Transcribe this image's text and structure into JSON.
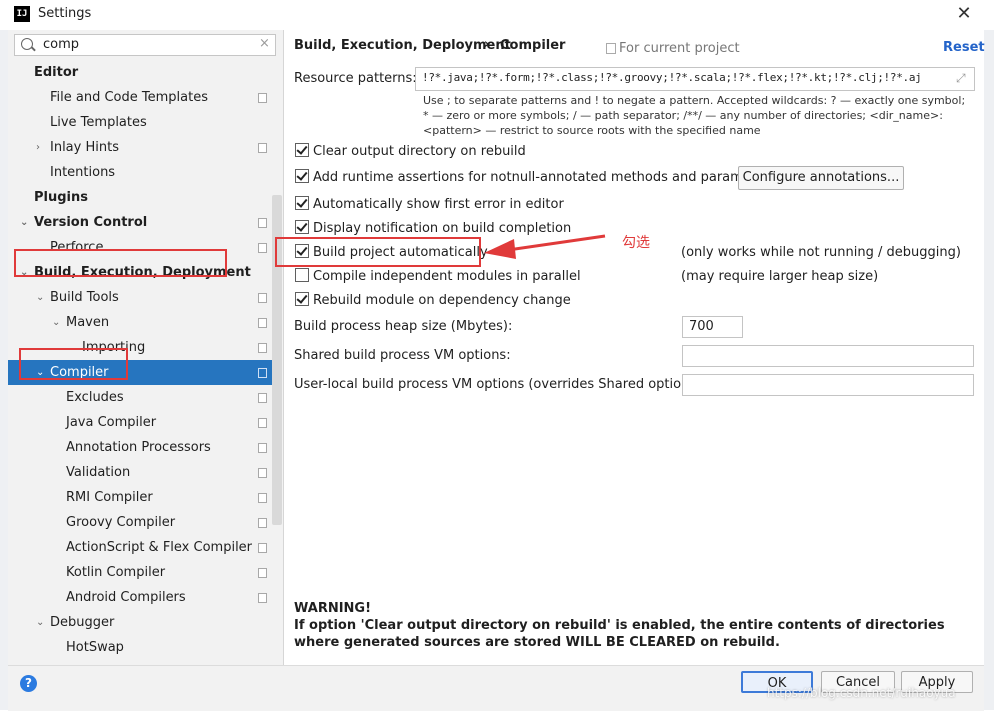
{
  "window": {
    "title": "Settings",
    "app_icon_text": "IJ"
  },
  "search": {
    "value": "comp",
    "clear_glyph": "×"
  },
  "tree": [
    {
      "label": "Editor",
      "bold": true,
      "indent": 26,
      "arrow": "",
      "page_icon": false
    },
    {
      "label": "File and Code Templates",
      "bold": false,
      "indent": 42,
      "arrow": "",
      "page_icon": true
    },
    {
      "label": "Live Templates",
      "bold": false,
      "indent": 42,
      "arrow": "",
      "page_icon": false
    },
    {
      "label": "Inlay Hints",
      "bold": false,
      "indent": 42,
      "arrow": "›",
      "page_icon": true
    },
    {
      "label": "Intentions",
      "bold": false,
      "indent": 42,
      "arrow": "",
      "page_icon": false
    },
    {
      "label": "Plugins",
      "bold": true,
      "indent": 26,
      "arrow": "",
      "page_icon": false
    },
    {
      "label": "Version Control",
      "bold": true,
      "indent": 26,
      "arrow": "⌄",
      "page_icon": true
    },
    {
      "label": "Perforce",
      "bold": false,
      "indent": 42,
      "arrow": "",
      "page_icon": true
    },
    {
      "label": "Build, Execution, Deployment",
      "bold": true,
      "indent": 26,
      "arrow": "⌄",
      "page_icon": false
    },
    {
      "label": "Build Tools",
      "bold": false,
      "indent": 42,
      "arrow": "⌄",
      "page_icon": true
    },
    {
      "label": "Maven",
      "bold": false,
      "indent": 58,
      "arrow": "⌄",
      "page_icon": true
    },
    {
      "label": "Importing",
      "bold": false,
      "indent": 74,
      "arrow": "",
      "page_icon": true
    },
    {
      "label": "Compiler",
      "bold": false,
      "indent": 42,
      "arrow": "⌄",
      "page_icon": true,
      "selected": true
    },
    {
      "label": "Excludes",
      "bold": false,
      "indent": 58,
      "arrow": "",
      "page_icon": true
    },
    {
      "label": "Java Compiler",
      "bold": false,
      "indent": 58,
      "arrow": "",
      "page_icon": true
    },
    {
      "label": "Annotation Processors",
      "bold": false,
      "indent": 58,
      "arrow": "",
      "page_icon": true
    },
    {
      "label": "Validation",
      "bold": false,
      "indent": 58,
      "arrow": "",
      "page_icon": true
    },
    {
      "label": "RMI Compiler",
      "bold": false,
      "indent": 58,
      "arrow": "",
      "page_icon": true
    },
    {
      "label": "Groovy Compiler",
      "bold": false,
      "indent": 58,
      "arrow": "",
      "page_icon": true
    },
    {
      "label": "ActionScript & Flex Compiler",
      "bold": false,
      "indent": 58,
      "arrow": "",
      "page_icon": true
    },
    {
      "label": "Kotlin Compiler",
      "bold": false,
      "indent": 58,
      "arrow": "",
      "page_icon": true
    },
    {
      "label": "Android Compilers",
      "bold": false,
      "indent": 58,
      "arrow": "",
      "page_icon": true
    },
    {
      "label": "Debugger",
      "bold": false,
      "indent": 42,
      "arrow": "⌄",
      "page_icon": false
    },
    {
      "label": "HotSwap",
      "bold": false,
      "indent": 58,
      "arrow": "",
      "page_icon": false
    }
  ],
  "header": {
    "breadcrumb_parent": "Build, Execution, Deployment",
    "breadcrumb_sep": "›",
    "breadcrumb_current": "Compiler",
    "scope": "For current project",
    "reset": "Reset"
  },
  "resource": {
    "label": "Resource patterns:",
    "value": "!?*.java;!?*.form;!?*.class;!?*.groovy;!?*.scala;!?*.flex;!?*.kt;!?*.clj;!?*.aj",
    "hint": "Use ; to separate patterns and ! to negate a pattern. Accepted wildcards: ? — exactly one symbol; * — zero or more symbols; / — path separator; /**/ — any number of directories; <dir_name>:<pattern> — restrict to source roots with the specified name"
  },
  "options": [
    {
      "label": "Clear output directory on rebuild",
      "checked": true
    },
    {
      "label": "Add runtime assertions for notnull-annotated methods and parameters",
      "checked": true
    },
    {
      "label": "Automatically show first error in editor",
      "checked": true
    },
    {
      "label": "Display notification on build completion",
      "checked": true
    },
    {
      "label": "Build project automatically",
      "checked": true
    },
    {
      "label": "Compile independent modules in parallel",
      "checked": false
    },
    {
      "label": "Rebuild module on dependency change",
      "checked": true
    }
  ],
  "configure_annotations": "Configure annotations...",
  "notes": {
    "build_auto": "(only works while not running / debugging)",
    "parallel": "(may require larger heap size)"
  },
  "fields": {
    "heap_label": "Build process heap size (Mbytes):",
    "heap_value": "700",
    "shared_vm_label": "Shared build process VM options:",
    "shared_vm_value": "",
    "user_vm_label": "User-local build process VM options (overrides Shared options):",
    "user_vm_value": ""
  },
  "warning": {
    "title": "WARNING!",
    "body": "If option 'Clear output directory on rebuild' is enabled, the entire contents of directories where generated sources are stored WILL BE CLEARED on rebuild."
  },
  "annotation": {
    "text": "勾选",
    "color": "#e03a3a"
  },
  "buttons": {
    "ok": "OK",
    "cancel": "Cancel",
    "apply": "Apply",
    "help": "?"
  },
  "watermark": "https://blog.csdn.net/ruihaoyua",
  "colors": {
    "selection": "#2675bf",
    "link": "#2464c9",
    "annotation_red": "#e03a3a"
  }
}
